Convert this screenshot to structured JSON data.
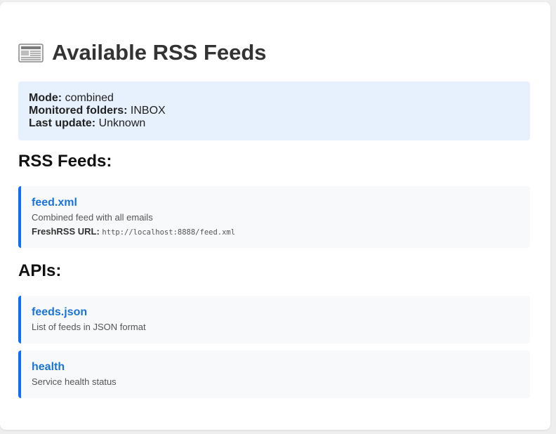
{
  "header": {
    "icon": "newspaper-icon",
    "title": "Available RSS Feeds"
  },
  "info": {
    "mode_label": "Mode:",
    "mode_value": "combined",
    "folders_label": "Monitored folders:",
    "folders_value": "INBOX",
    "update_label": "Last update:",
    "update_value": "Unknown"
  },
  "rss_section": {
    "heading": "RSS Feeds:",
    "feeds": [
      {
        "name": "feed.xml",
        "description": "Combined feed with all emails",
        "url_label": "FreshRSS URL:",
        "url": "http://localhost:8888/feed.xml"
      }
    ]
  },
  "api_section": {
    "heading": "APIs:",
    "items": [
      {
        "name": "feeds.json",
        "description": "List of feeds in JSON format"
      },
      {
        "name": "health",
        "description": "Service health status"
      }
    ]
  },
  "colors": {
    "accent": "#0d6efd",
    "link": "#1a73d9",
    "info_bg": "#e7f1fd",
    "item_bg": "#f8f9fa"
  }
}
